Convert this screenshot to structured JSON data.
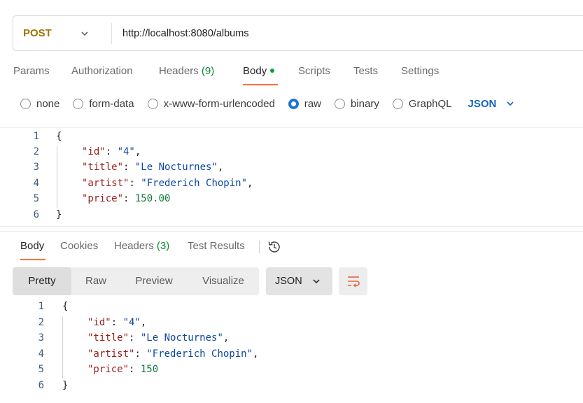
{
  "request": {
    "method": "POST",
    "url": "http://localhost:8080/albums"
  },
  "request_tabs": [
    {
      "label": "Params"
    },
    {
      "label": "Authorization"
    },
    {
      "label": "Headers",
      "count": "(9)"
    },
    {
      "label": "Body"
    },
    {
      "label": "Scripts"
    },
    {
      "label": "Tests"
    },
    {
      "label": "Settings"
    }
  ],
  "body_types": [
    {
      "label": "none"
    },
    {
      "label": "form-data"
    },
    {
      "label": "x-www-form-urlencoded"
    },
    {
      "label": "raw",
      "selected": true
    },
    {
      "label": "binary"
    },
    {
      "label": "GraphQL"
    }
  ],
  "body_format": "JSON",
  "request_body": {
    "line_numbers": [
      "1",
      "2",
      "3",
      "4",
      "5",
      "6"
    ],
    "open_brace": "{",
    "close_brace": "}",
    "fields": [
      {
        "key": "\"id\"",
        "value": "\"4\"",
        "sep": ": ",
        "end": ","
      },
      {
        "key": "\"title\"",
        "value": "\"Le Nocturnes\"",
        "sep": ": ",
        "end": ","
      },
      {
        "key": "\"artist\"",
        "value": "\"Frederich Chopin\"",
        "sep": ": ",
        "end": ","
      },
      {
        "key": "\"price\"",
        "value": "150.00",
        "sep": ": ",
        "end": ""
      }
    ]
  },
  "response_tabs": [
    {
      "label": "Body"
    },
    {
      "label": "Cookies"
    },
    {
      "label": "Headers",
      "count": "(3)"
    },
    {
      "label": "Test Results"
    }
  ],
  "view_modes": [
    "Pretty",
    "Raw",
    "Preview",
    "Visualize"
  ],
  "response_format": "JSON",
  "response_body": {
    "line_numbers": [
      "1",
      "2",
      "3",
      "4",
      "5",
      "6"
    ],
    "open_brace": "{",
    "close_brace": "}",
    "fields": [
      {
        "key": "\"id\"",
        "value": "\"4\"",
        "sep": ": ",
        "end": ","
      },
      {
        "key": "\"title\"",
        "value": "\"Le Nocturnes\"",
        "sep": ": ",
        "end": ","
      },
      {
        "key": "\"artist\"",
        "value": "\"Frederich Chopin\"",
        "sep": ": ",
        "end": ","
      },
      {
        "key": "\"price\"",
        "value": "150",
        "sep": ": ",
        "end": ""
      }
    ]
  },
  "colors": {
    "method": "#9e7400",
    "accent_tab": "#ff6c37",
    "body_dot": "#0c9d3f",
    "radio_selected": "#1976d2",
    "json_key": "#9b1c1c",
    "json_string": "#0d47a1",
    "json_number": "#0d7a3a"
  },
  "icons": {
    "method_dropdown": "chevron-down-icon",
    "format_dropdown": "chevron-down-icon",
    "history": "history-icon",
    "wrap": "wrap-lines-icon"
  }
}
